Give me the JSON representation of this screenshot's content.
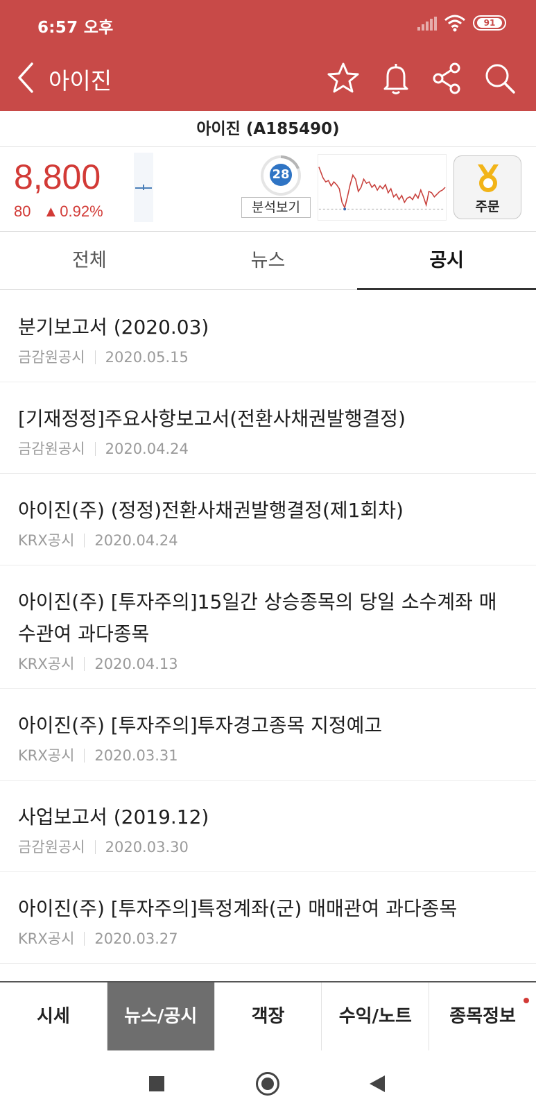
{
  "status_bar": {
    "time": "6:57 오후",
    "battery": "91"
  },
  "header": {
    "title": "아이진"
  },
  "stock": {
    "name": "아이진 (A185490)",
    "price": "8,800",
    "change_amount": "80",
    "change_symbol": "▲",
    "change_percent": "0.92%",
    "analysis_score": "28",
    "analysis_label": "분석보기",
    "order_label": "주문"
  },
  "tabs": [
    {
      "label": "전체"
    },
    {
      "label": "뉴스"
    },
    {
      "label": "공시"
    }
  ],
  "disclosures": [
    {
      "title": "분기보고서 (2020.03)",
      "source": "금감원공시",
      "date": "2020.05.15"
    },
    {
      "title": "[기재정정]주요사항보고서(전환사채권발행결정)",
      "source": "금감원공시",
      "date": "2020.04.24"
    },
    {
      "title": "아이진(주) (정정)전환사채권발행결정(제1회차)",
      "source": "KRX공시",
      "date": "2020.04.24"
    },
    {
      "title": "아이진(주) [투자주의]15일간 상승종목의 당일 소수계좌 매수관여 과다종목",
      "source": "KRX공시",
      "date": "2020.04.13"
    },
    {
      "title": "아이진(주) [투자주의]투자경고종목 지정예고",
      "source": "KRX공시",
      "date": "2020.03.31"
    },
    {
      "title": "사업보고서 (2019.12)",
      "source": "금감원공시",
      "date": "2020.03.30"
    },
    {
      "title": "아이진(주) [투자주의]특정계좌(군) 매매관여 과다종목",
      "source": "KRX공시",
      "date": "2020.03.27"
    }
  ],
  "bottom_nav": [
    {
      "label": "시세"
    },
    {
      "label": "뉴스/공시"
    },
    {
      "label": "객장"
    },
    {
      "label": "수익/노트"
    },
    {
      "label": "종목정보"
    }
  ],
  "colors": {
    "brand": "#c84a48",
    "up": "#d23a36",
    "score": "#2f74c4"
  }
}
